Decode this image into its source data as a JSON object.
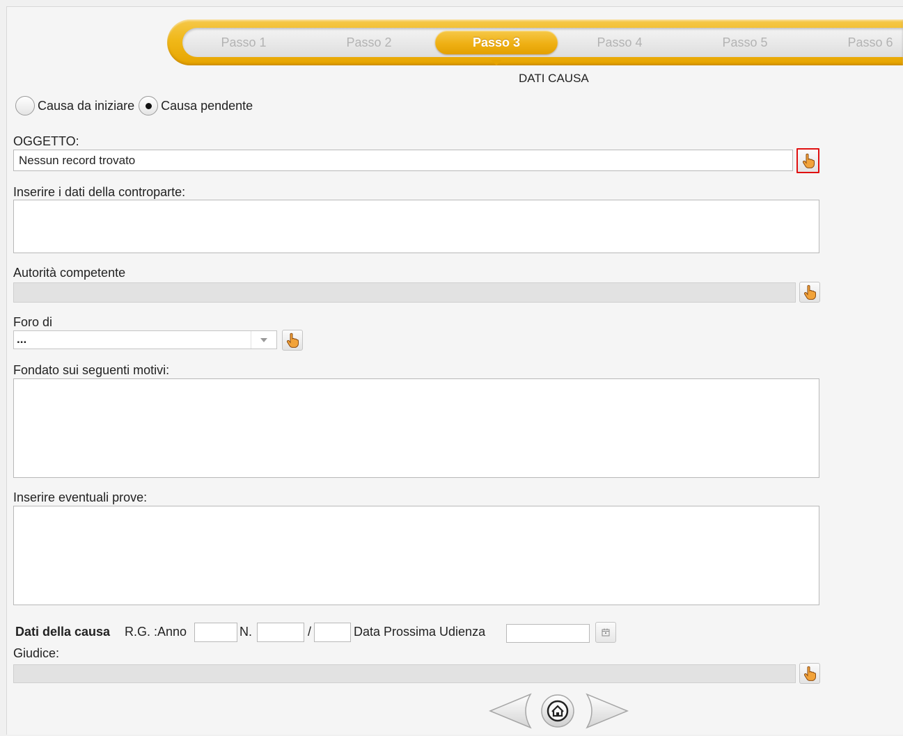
{
  "steps": [
    "Passo 1",
    "Passo 2",
    "Passo 3",
    "Passo 4",
    "Passo 5",
    "Passo 6"
  ],
  "active_step": "Passo 3",
  "section_title": "DATI CAUSA",
  "radios": {
    "option1": "Causa da iniziare",
    "option2": "Causa pendente",
    "selected": "Causa pendente"
  },
  "oggetto": {
    "label": "OGGETTO:",
    "value": "Nessun record trovato"
  },
  "controparte": {
    "label": "Inserire i dati della controparte:",
    "value": ""
  },
  "autorita": {
    "label": "Autorità competente",
    "value": ""
  },
  "foro": {
    "label": "Foro di",
    "selected": "..."
  },
  "motivi": {
    "label": "Fondato sui seguenti motivi:",
    "value": ""
  },
  "prove": {
    "label": "Inserire eventuali prove:",
    "value": ""
  },
  "dati_causa": {
    "title": "Dati della causa",
    "rg_anno_label": "R.G. :Anno",
    "n_label": "N.",
    "slash": "/",
    "data_udienza_label": "Data Prossima Udienza",
    "anno": "",
    "n1": "",
    "n2": "",
    "data": ""
  },
  "giudice": {
    "label": "Giudice:",
    "value": ""
  },
  "icons": {
    "hand": "pointing-hand-icon",
    "calendar": "calendar-icon",
    "prev": "arrow-left-icon",
    "home": "home-icon",
    "next": "arrow-right-icon"
  },
  "colors": {
    "accent": "#f0b818",
    "highlight_border": "#e01010"
  }
}
